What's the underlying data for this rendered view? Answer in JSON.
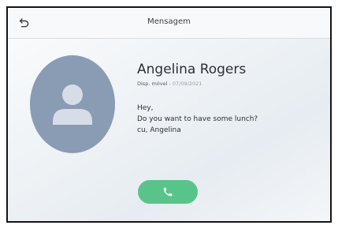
{
  "header": {
    "title": "Mensagem",
    "back_icon": "back-arrow-icon"
  },
  "contact": {
    "name": "Angelina Rogers",
    "source": "Disp. móvel",
    "separator": " - ",
    "date": "07/09/2021",
    "avatar_icon": "person-avatar-icon"
  },
  "message": {
    "lines": [
      "Hey,",
      "Do you want to have some lunch?",
      "cu, Angelina"
    ]
  },
  "actions": {
    "call_icon": "phone-icon"
  },
  "colors": {
    "call_button": "#59c48a",
    "avatar_background": "#8a9bb4",
    "avatar_figure": "#d7dde6"
  }
}
